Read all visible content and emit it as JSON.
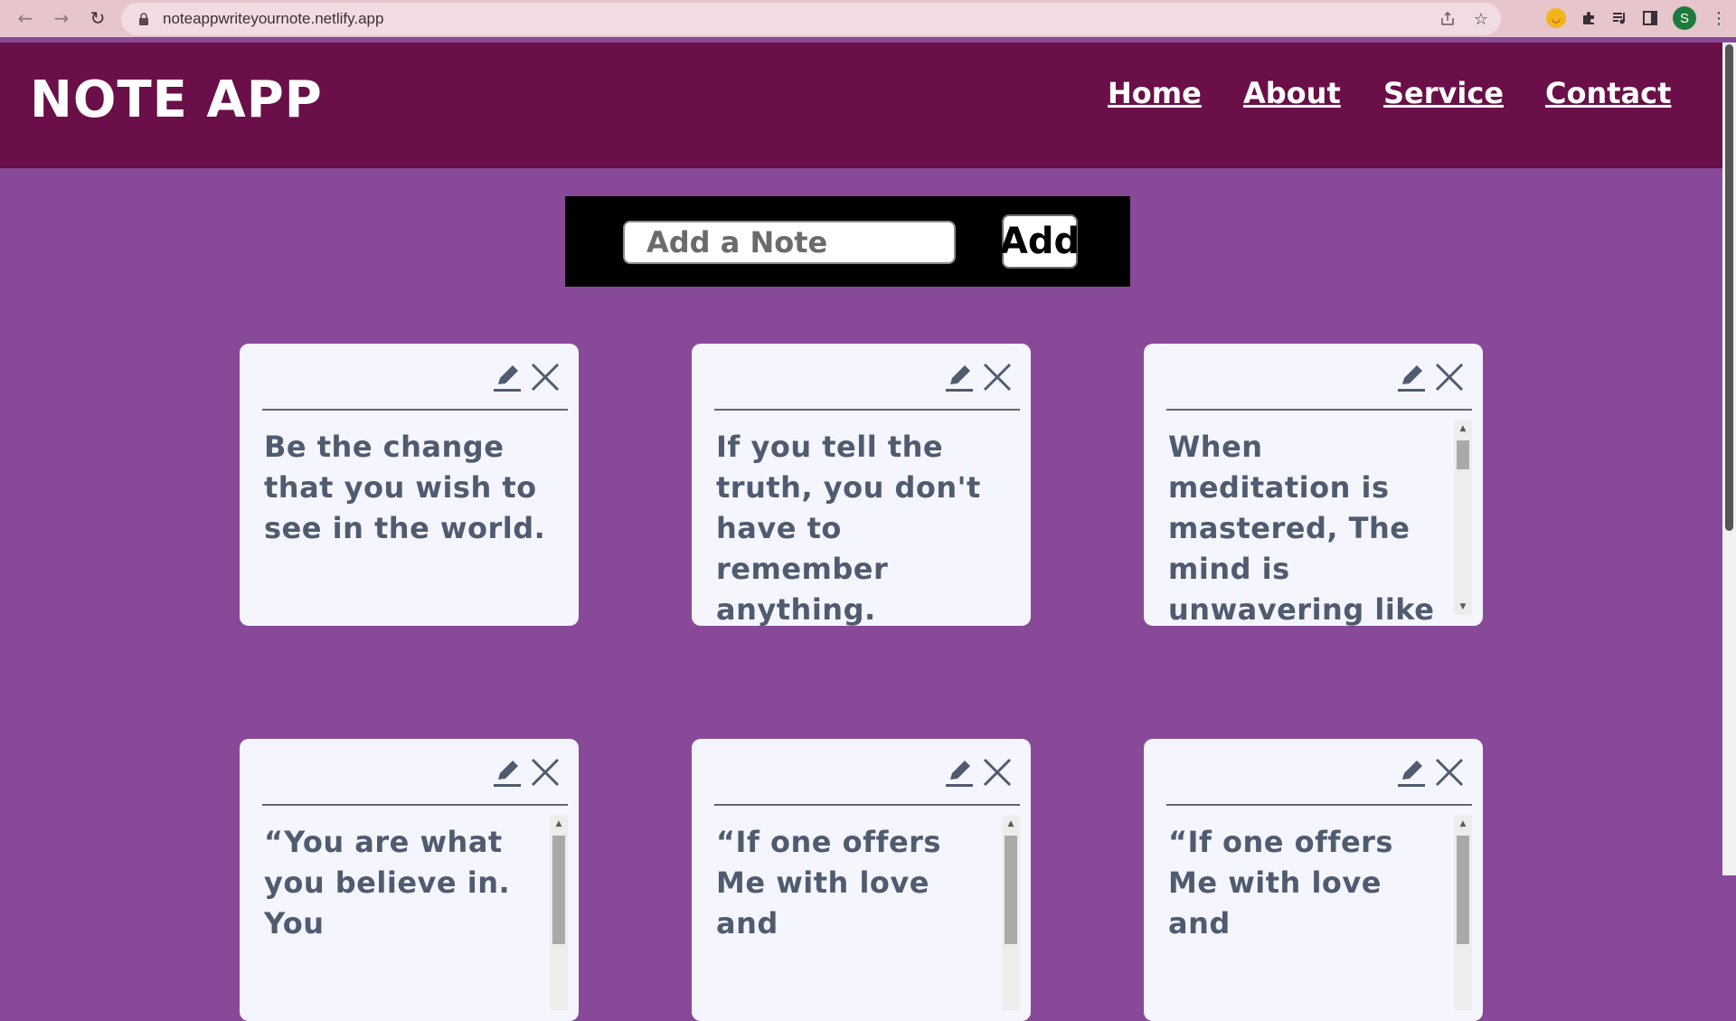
{
  "browser": {
    "url": "noteappwriteyournote.netlify.app",
    "profile_initial": "S"
  },
  "header": {
    "brand": "NOTE APP",
    "nav": [
      "Home",
      "About",
      "Service",
      "Contact"
    ]
  },
  "composer": {
    "placeholder": "Add a Note",
    "button_label": "Add"
  },
  "notes": [
    {
      "text": "Be the change that you wish to see in the world."
    },
    {
      "text": "If you tell the truth, you don't have to remember anything."
    },
    {
      "text": "When meditation is mastered, The mind is unwavering like the Flame of a"
    },
    {
      "text": "“You are what you believe in. You"
    },
    {
      "text": "“If one offers Me with love and"
    },
    {
      "text": "“If one offers Me with love and"
    }
  ],
  "colors": {
    "page_bg": "#884a98",
    "header_bg": "#6a0f48",
    "card_bg": "#f4f5fd",
    "note_text": "#4f5b6e"
  }
}
